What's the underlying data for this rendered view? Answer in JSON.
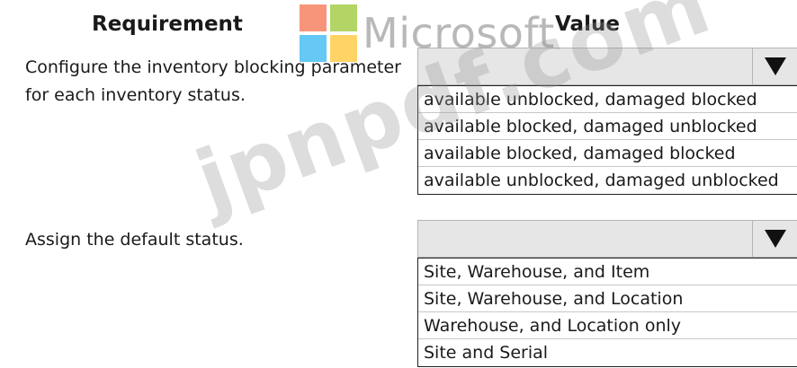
{
  "headers": {
    "requirement": "Requirement",
    "value": "Value"
  },
  "rows": [
    {
      "requirement_lines": [
        "Configure the inventory blocking parameter",
        "for each inventory status."
      ],
      "selected": "",
      "options": [
        "available unblocked, damaged blocked",
        "available blocked, damaged unblocked",
        "available blocked, damaged blocked",
        "available unblocked, damaged unblocked"
      ]
    },
    {
      "requirement_lines": [
        "Assign the default status."
      ],
      "selected": "",
      "options": [
        "Site, Warehouse, and Item",
        "Site, Warehouse, and Location",
        "Warehouse, and Location only",
        "Site and Serial"
      ]
    }
  ],
  "watermarks": {
    "logo_text": "Microsoft",
    "logo_colors": [
      "#f25022",
      "#7fba00",
      "#00a4ef",
      "#ffb900"
    ],
    "overlay_text": "jpnpdf.com"
  },
  "icons": {
    "dropdown_arrow": "triangle-down-icon"
  }
}
